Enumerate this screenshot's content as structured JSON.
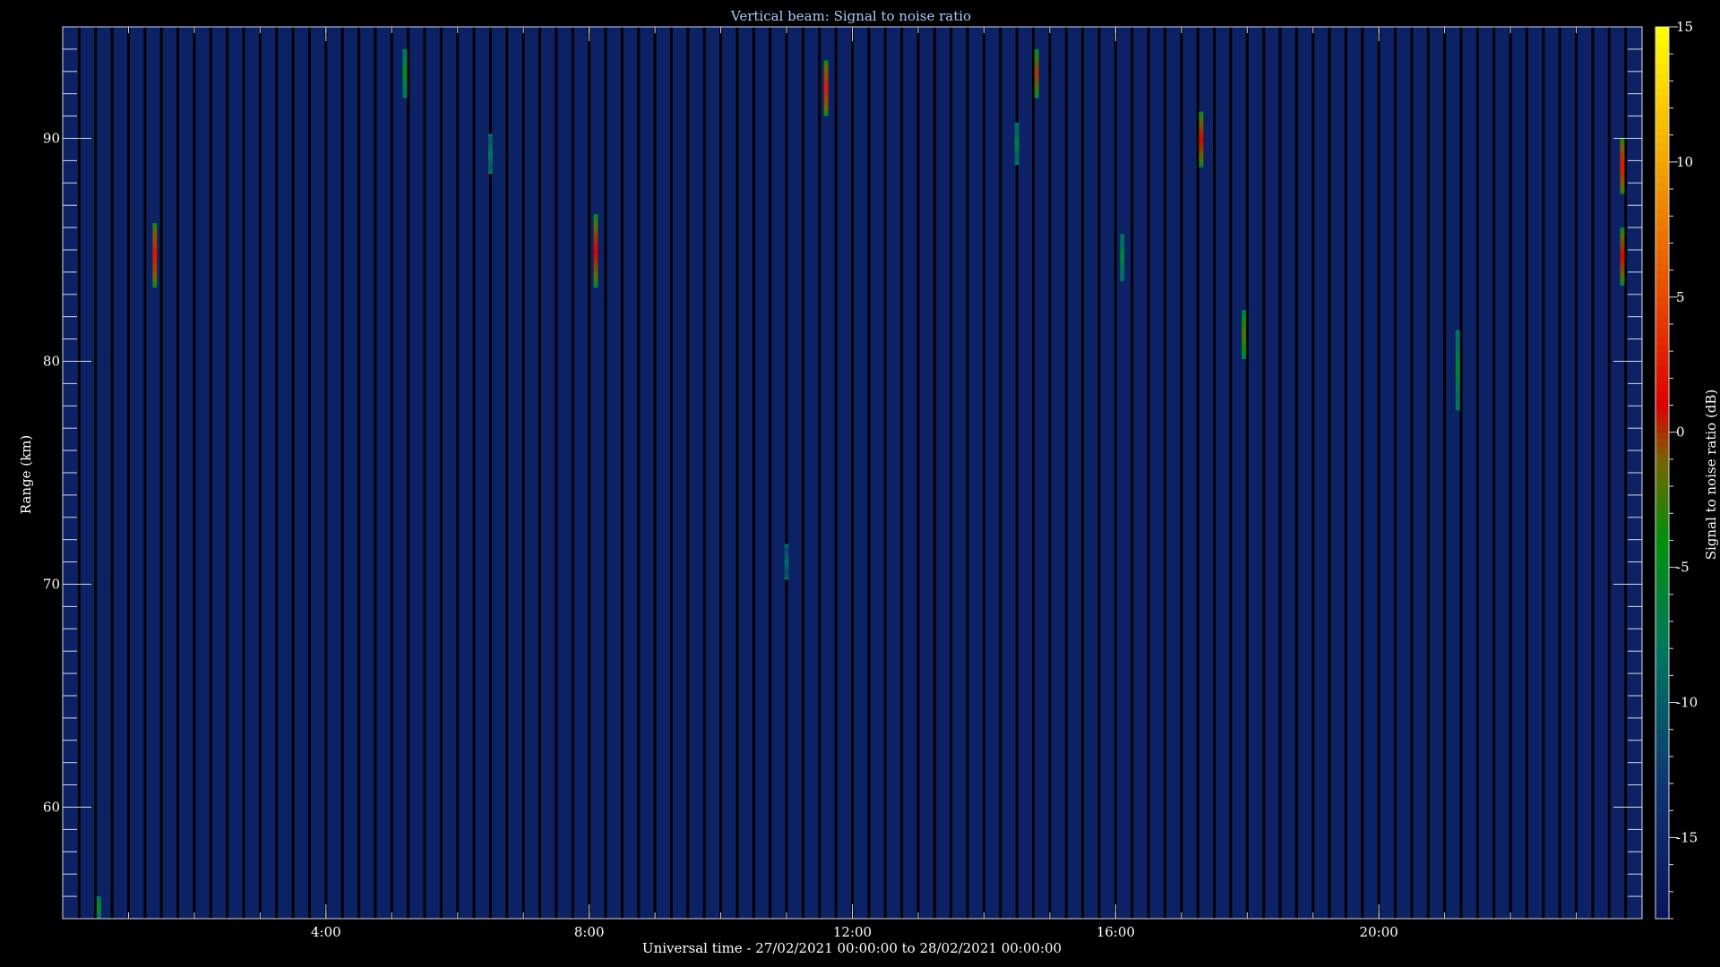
{
  "chart_data": {
    "type": "heatmap",
    "title": "Vertical beam: Signal to noise ratio",
    "xlabel": "Universal time - 27/02/2021 00:00:00 to 28/02/2021 00:00:00",
    "ylabel": "Range (km)",
    "colorbar_label": "Signal to noise ratio (dB)",
    "xlim": [
      0,
      24
    ],
    "ylim": [
      55,
      95
    ],
    "clim": [
      -18,
      15
    ],
    "x_ticks": [
      4,
      8,
      12,
      16,
      20
    ],
    "x_tick_labels": [
      "4:00",
      "8:00",
      "12:00",
      "16:00",
      "20:00"
    ],
    "y_ticks": [
      60,
      70,
      80,
      90
    ],
    "y_tick_labels": [
      "60",
      "70",
      "80",
      "90"
    ],
    "colorbar_ticks": [
      -15,
      -10,
      -5,
      0,
      5,
      10,
      15
    ],
    "colorbar_tick_labels": [
      "-15",
      "-10",
      "-5",
      "0",
      "5",
      "10",
      "15"
    ],
    "background_level_db": -16,
    "data_gap_interval_hours": 0.25,
    "echoes": [
      {
        "time": 1.4,
        "range_min": 83.3,
        "range_max": 86.2,
        "peak_db": 2
      },
      {
        "time": 5.2,
        "range_min": 91.8,
        "range_max": 94,
        "peak_db": -5
      },
      {
        "time": 6.5,
        "range_min": 88.4,
        "range_max": 90.2,
        "peak_db": -8
      },
      {
        "time": 8.1,
        "range_min": 83.3,
        "range_max": 86.6,
        "peak_db": 1
      },
      {
        "time": 11.0,
        "range_min": 70.2,
        "range_max": 71.8,
        "peak_db": -9
      },
      {
        "time": 11.6,
        "range_min": 91.0,
        "range_max": 93.5,
        "peak_db": 2
      },
      {
        "time": 14.5,
        "range_min": 88.8,
        "range_max": 90.7,
        "peak_db": -7
      },
      {
        "time": 14.8,
        "range_min": 91.8,
        "range_max": 94,
        "peak_db": 0
      },
      {
        "time": 16.1,
        "range_min": 83.6,
        "range_max": 85.7,
        "peak_db": -6
      },
      {
        "time": 17.3,
        "range_min": 88.7,
        "range_max": 91.2,
        "peak_db": 1
      },
      {
        "time": 17.95,
        "range_min": 80.1,
        "range_max": 82.3,
        "peak_db": -2
      },
      {
        "time": 21.2,
        "range_min": 77.8,
        "range_max": 81.4,
        "peak_db": -6
      },
      {
        "time": 23.7,
        "range_min": 87.5,
        "range_max": 90.0,
        "peak_db": 2
      },
      {
        "time": 23.7,
        "range_min": 83.4,
        "range_max": 86.0,
        "peak_db": 1
      },
      {
        "time": 0.55,
        "range_min": 55,
        "range_max": 56,
        "peak_db": -5
      }
    ]
  }
}
